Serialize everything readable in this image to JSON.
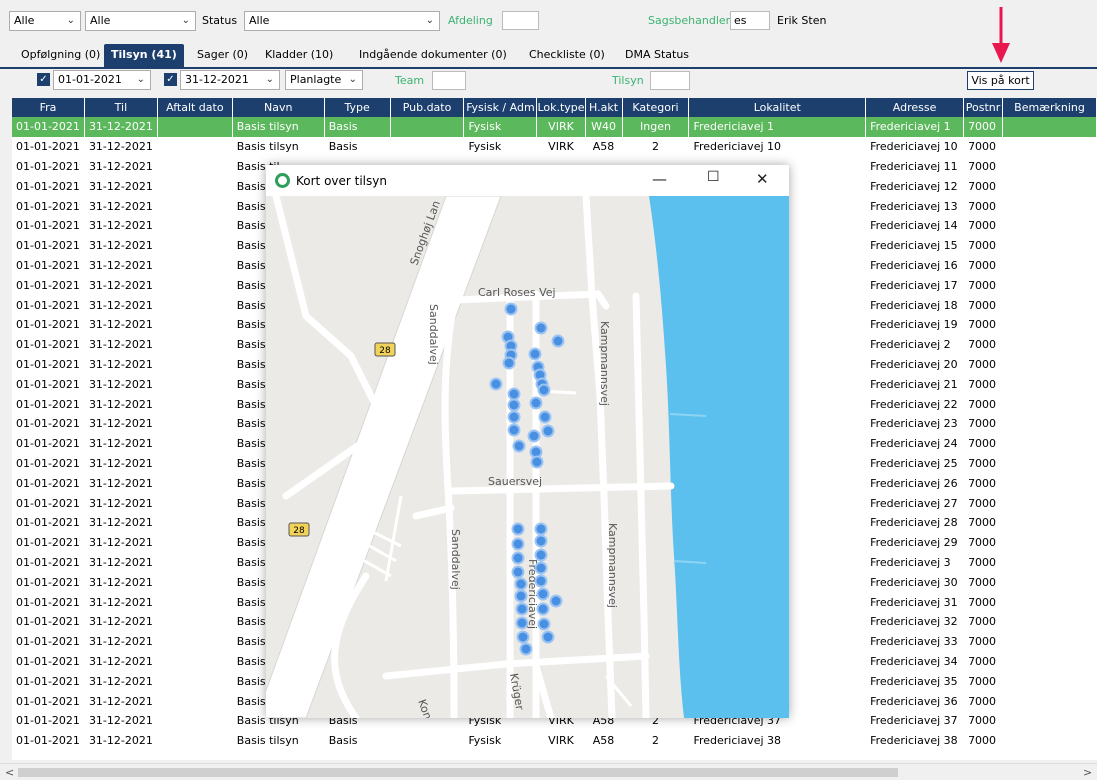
{
  "filters": {
    "combo1": "Alle",
    "combo2": "Alle",
    "status_label": "Status",
    "status_value": "Alle",
    "afdeling_label": "Afdeling",
    "afdeling_value": "",
    "sagsbehandler_label": "Sagsbehandler",
    "sagsbehandler_value": "es",
    "sagsbehandler_name": "Erik Sten"
  },
  "tabs": [
    {
      "label": "Opfølgning (0)"
    },
    {
      "label": "Tilsyn (41)"
    },
    {
      "label": "Sager (0)"
    },
    {
      "label": "Kladder (10)"
    },
    {
      "label": "Indgående dokumenter (0)"
    },
    {
      "label": "Checkliste (0)"
    },
    {
      "label": "DMA Status"
    }
  ],
  "subfilters": {
    "from_date": "01-01-2021",
    "to_date": "31-12-2021",
    "planned": "Planlagte",
    "team_label": "Team",
    "team_value": "",
    "tilsyn_label": "Tilsyn",
    "tilsyn_value": "",
    "show_on_map": "Vis på kort"
  },
  "columns": [
    "Fra",
    "Til",
    "Aftalt dato",
    "Navn",
    "Type",
    "Pub.dato",
    "Fysisk / Adm",
    "Lok.type",
    "H.akt",
    "Kategori",
    "Lokalitet",
    "Adresse",
    "Postnr",
    "Bemærkning"
  ],
  "rows": [
    [
      "01-01-2021",
      "31-12-2021",
      "",
      "Basis tilsyn",
      "Basis",
      "",
      "Fysisk",
      "VIRK",
      "W40",
      "Ingen",
      "Fredericiavej 1",
      "Fredericiavej 1",
      "7000",
      ""
    ],
    [
      "01-01-2021",
      "31-12-2021",
      "",
      "Basis tilsyn",
      "Basis",
      "",
      "Fysisk",
      "VIRK",
      "A58",
      "2",
      "Fredericiavej 10",
      "Fredericiavej 10",
      "7000",
      ""
    ],
    [
      "01-01-2021",
      "31-12-2021",
      "",
      "Basis til",
      "",
      "",
      "",
      "",
      "",
      "",
      "",
      "Fredericiavej 11",
      "7000",
      ""
    ],
    [
      "01-01-2021",
      "31-12-2021",
      "",
      "Basis til",
      "",
      "",
      "",
      "",
      "",
      "",
      "",
      "Fredericiavej 12",
      "7000",
      ""
    ],
    [
      "01-01-2021",
      "31-12-2021",
      "",
      "Basis til",
      "",
      "",
      "",
      "",
      "",
      "",
      "",
      "Fredericiavej 13",
      "7000",
      ""
    ],
    [
      "01-01-2021",
      "31-12-2021",
      "",
      "Basis til",
      "",
      "",
      "",
      "",
      "",
      "",
      "",
      "Fredericiavej 14",
      "7000",
      ""
    ],
    [
      "01-01-2021",
      "31-12-2021",
      "",
      "Basis til",
      "",
      "",
      "",
      "",
      "",
      "",
      "",
      "Fredericiavej 15",
      "7000",
      ""
    ],
    [
      "01-01-2021",
      "31-12-2021",
      "",
      "Basis til",
      "",
      "",
      "",
      "",
      "",
      "",
      "",
      "Fredericiavej 16",
      "7000",
      ""
    ],
    [
      "01-01-2021",
      "31-12-2021",
      "",
      "Basis til",
      "",
      "",
      "",
      "",
      "",
      "",
      "",
      "Fredericiavej 17",
      "7000",
      ""
    ],
    [
      "01-01-2021",
      "31-12-2021",
      "",
      "Basis til",
      "",
      "",
      "",
      "",
      "",
      "",
      "",
      "Fredericiavej 18",
      "7000",
      ""
    ],
    [
      "01-01-2021",
      "31-12-2021",
      "",
      "Basis til",
      "",
      "",
      "",
      "",
      "",
      "",
      "",
      "Fredericiavej 19",
      "7000",
      ""
    ],
    [
      "01-01-2021",
      "31-12-2021",
      "",
      "Basis til",
      "",
      "",
      "",
      "",
      "",
      "",
      "",
      "Fredericiavej 2",
      "7000",
      ""
    ],
    [
      "01-01-2021",
      "31-12-2021",
      "",
      "Basis til",
      "",
      "",
      "",
      "",
      "",
      "",
      "",
      "Fredericiavej 20",
      "7000",
      ""
    ],
    [
      "01-01-2021",
      "31-12-2021",
      "",
      "Basis til",
      "",
      "",
      "",
      "",
      "",
      "",
      "",
      "Fredericiavej 21",
      "7000",
      ""
    ],
    [
      "01-01-2021",
      "31-12-2021",
      "",
      "Basis til",
      "",
      "",
      "",
      "",
      "",
      "",
      "",
      "Fredericiavej 22",
      "7000",
      ""
    ],
    [
      "01-01-2021",
      "31-12-2021",
      "",
      "Basis til",
      "",
      "",
      "",
      "",
      "",
      "",
      "",
      "Fredericiavej 23",
      "7000",
      ""
    ],
    [
      "01-01-2021",
      "31-12-2021",
      "",
      "Basis til",
      "",
      "",
      "",
      "",
      "",
      "",
      "",
      "Fredericiavej 24",
      "7000",
      ""
    ],
    [
      "01-01-2021",
      "31-12-2021",
      "",
      "Basis til",
      "",
      "",
      "",
      "",
      "",
      "",
      "",
      "Fredericiavej 25",
      "7000",
      ""
    ],
    [
      "01-01-2021",
      "31-12-2021",
      "",
      "Basis til",
      "",
      "",
      "",
      "",
      "",
      "",
      "",
      "Fredericiavej 26",
      "7000",
      ""
    ],
    [
      "01-01-2021",
      "31-12-2021",
      "",
      "Basis til",
      "",
      "",
      "",
      "",
      "",
      "",
      "",
      "Fredericiavej 27",
      "7000",
      ""
    ],
    [
      "01-01-2021",
      "31-12-2021",
      "",
      "Basis til",
      "",
      "",
      "",
      "",
      "",
      "",
      "",
      "Fredericiavej 28",
      "7000",
      ""
    ],
    [
      "01-01-2021",
      "31-12-2021",
      "",
      "Basis til",
      "",
      "",
      "",
      "",
      "",
      "",
      "",
      "Fredericiavej 29",
      "7000",
      ""
    ],
    [
      "01-01-2021",
      "31-12-2021",
      "",
      "Basis til",
      "",
      "",
      "",
      "",
      "",
      "",
      "",
      "Fredericiavej 3",
      "7000",
      ""
    ],
    [
      "01-01-2021",
      "31-12-2021",
      "",
      "Basis til",
      "",
      "",
      "",
      "",
      "",
      "",
      "",
      "Fredericiavej 30",
      "7000",
      ""
    ],
    [
      "01-01-2021",
      "31-12-2021",
      "",
      "Basis til",
      "",
      "",
      "",
      "",
      "",
      "",
      "",
      "Fredericiavej 31",
      "7000",
      ""
    ],
    [
      "01-01-2021",
      "31-12-2021",
      "",
      "Basis til",
      "",
      "",
      "",
      "",
      "",
      "",
      "",
      "Fredericiavej 32",
      "7000",
      ""
    ],
    [
      "01-01-2021",
      "31-12-2021",
      "",
      "Basis til",
      "",
      "",
      "",
      "",
      "",
      "",
      "",
      "Fredericiavej 33",
      "7000",
      ""
    ],
    [
      "01-01-2021",
      "31-12-2021",
      "",
      "Basis til",
      "",
      "",
      "",
      "",
      "",
      "",
      "",
      "Fredericiavej 34",
      "7000",
      ""
    ],
    [
      "01-01-2021",
      "31-12-2021",
      "",
      "Basis til",
      "",
      "",
      "",
      "",
      "",
      "",
      "",
      "Fredericiavej 35",
      "7000",
      ""
    ],
    [
      "01-01-2021",
      "31-12-2021",
      "",
      "Basis til",
      "",
      "",
      "",
      "",
      "",
      "",
      "",
      "Fredericiavej 36",
      "7000",
      ""
    ],
    [
      "01-01-2021",
      "31-12-2021",
      "",
      "Basis tilsyn",
      "Basis",
      "",
      "Fysisk",
      "VIRK",
      "A58",
      "2",
      "Fredericiavej 37",
      "Fredericiavej 37",
      "7000",
      ""
    ],
    [
      "01-01-2021",
      "31-12-2021",
      "",
      "Basis tilsyn",
      "Basis",
      "",
      "Fysisk",
      "VIRK",
      "A58",
      "2",
      "Fredericiavej 38",
      "Fredericiavej 38",
      "7000",
      ""
    ]
  ],
  "map_window": {
    "title": "Kort over tilsyn",
    "minimize": "—",
    "maximize": "☐",
    "close": "✕",
    "labels": {
      "snoghoj": "Snoghøj Lan",
      "carl": "Carl Roses Vej",
      "sand1": "Sanddalvej",
      "sand2": "Sanddalvej",
      "kamp1": "Kampmannsvej",
      "kamp2": "Kampmannsvej",
      "sauers": "Sauersvej",
      "fred": "Fredericiavej",
      "kruger": "Krüger",
      "kon": "Kon",
      "r28a": "28",
      "r28b": "28"
    }
  },
  "colors": {
    "accent": "#1d3f6e",
    "selected_row": "#5cb85c",
    "water": "#5cc0ee",
    "marker": "#4a90e2",
    "green_label": "#3cb371",
    "arrow": "#e8174f"
  }
}
